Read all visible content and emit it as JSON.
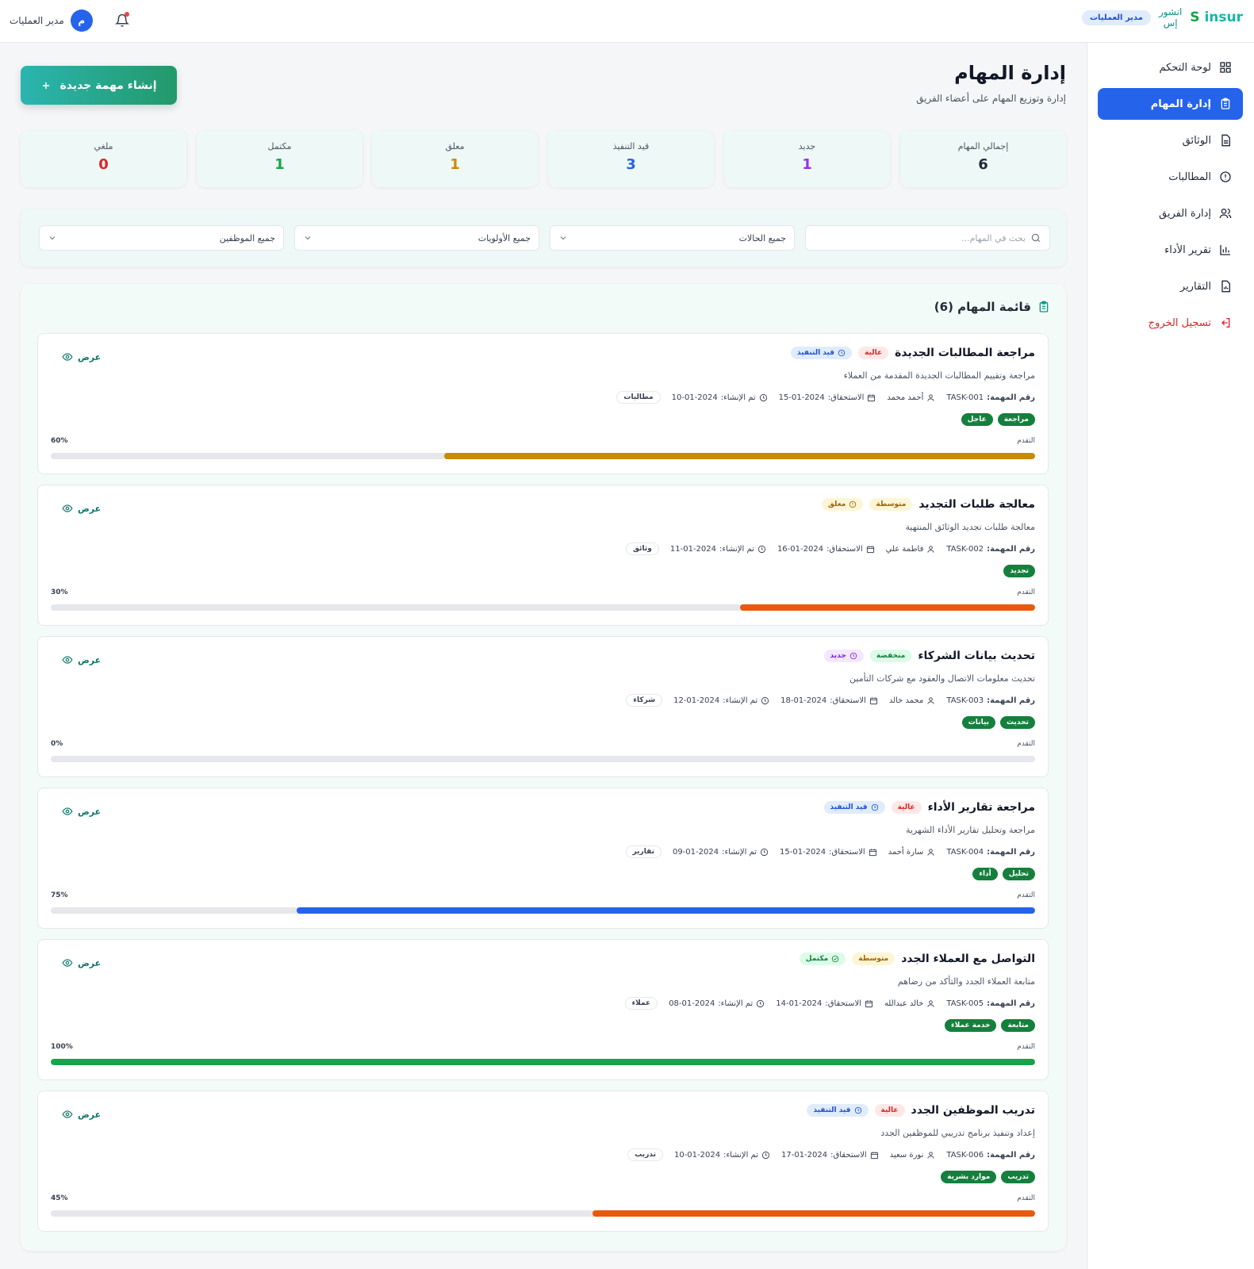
{
  "brand": {
    "logo_main": "insur",
    "logo_s": "S",
    "arabic_line1": "انشور",
    "arabic_line2": "إس",
    "role_pill": "مدير العمليات"
  },
  "user": {
    "name": "مدير العمليات",
    "avatar_letter": "م"
  },
  "sidebar": {
    "items": [
      {
        "label": "لوحة التحكم",
        "icon": "dashboard-icon"
      },
      {
        "label": "إدارة المهام",
        "icon": "clipboard-icon",
        "active": true
      },
      {
        "label": "الوثائق",
        "icon": "document-icon"
      },
      {
        "label": "المطالبات",
        "icon": "alert-circle-icon"
      },
      {
        "label": "إدارة الفريق",
        "icon": "users-icon"
      },
      {
        "label": "تقرير الأداء",
        "icon": "bar-chart-icon"
      },
      {
        "label": "التقارير",
        "icon": "report-icon"
      },
      {
        "label": "تسجيل الخروج",
        "icon": "logout-icon"
      }
    ]
  },
  "page": {
    "title": "إدارة المهام",
    "subtitle": "إدارة وتوزيع المهام على أعضاء الفريق",
    "create_button": "إنشاء مهمة جديدة"
  },
  "stats": [
    {
      "label": "إجمالي المهام",
      "value": "6",
      "color": "#1f2937"
    },
    {
      "label": "جديد",
      "value": "1",
      "color": "#9333ea"
    },
    {
      "label": "قيد التنفيذ",
      "value": "3",
      "color": "#2563eb"
    },
    {
      "label": "معلق",
      "value": "1",
      "color": "#ca8a04"
    },
    {
      "label": "مكتمل",
      "value": "1",
      "color": "#16a34a"
    },
    {
      "label": "ملغي",
      "value": "0",
      "color": "#dc2626"
    }
  ],
  "filters": {
    "search_placeholder": "بحث في المهام...",
    "status": "جميع الحالات",
    "priority": "جميع الأولويات",
    "employee": "جميع الموظفين"
  },
  "list": {
    "title": "قائمة المهام (6)"
  },
  "labels": {
    "task_no": "رقم المهمة:",
    "due": "الاستحقاق:",
    "created": "تم الإنشاء:",
    "progress": "التقدم",
    "view": "عرض"
  },
  "tasks": [
    {
      "title": "مراجعة المطالبات الجديدة",
      "priority": "عالية",
      "priority_class": "pr-high",
      "status": "قيد التنفيذ",
      "status_class": "st-progress",
      "description": "مراجعة وتقييم المطالبات الجديدة المقدمة من العملاء",
      "id": "TASK-001",
      "assignee": "أحمد محمد",
      "due": "15-01-2024",
      "created": "10-01-2024",
      "category": "مطالبات",
      "tags": [
        "مراجعة",
        "عاجل"
      ],
      "progress": 60,
      "progress_text": "60%",
      "bar_color": "#ca8a04"
    },
    {
      "title": "معالجة طلبات التجديد",
      "priority": "متوسطة",
      "priority_class": "pr-med",
      "status": "معلق",
      "status_class": "st-pending",
      "description": "معالجة طلبات تجديد الوثائق المنتهية",
      "id": "TASK-002",
      "assignee": "فاطمة علي",
      "due": "16-01-2024",
      "created": "11-01-2024",
      "category": "وثائق",
      "tags": [
        "تجديد"
      ],
      "progress": 30,
      "progress_text": "30%",
      "bar_color": "#ea580c"
    },
    {
      "title": "تحديث بيانات الشركاء",
      "priority": "منخفضة",
      "priority_class": "pr-low",
      "status": "جديد",
      "status_class": "st-new",
      "description": "تحديث معلومات الاتصال والعقود مع شركات التأمين",
      "id": "TASK-003",
      "assignee": "محمد خالد",
      "due": "18-01-2024",
      "created": "12-01-2024",
      "category": "شركاء",
      "tags": [
        "تحديث",
        "بيانات"
      ],
      "progress": 0,
      "progress_text": "0%",
      "bar_color": "#9ca3af"
    },
    {
      "title": "مراجعة تقارير الأداء",
      "priority": "عالية",
      "priority_class": "pr-high",
      "status": "قيد التنفيذ",
      "status_class": "st-progress",
      "description": "مراجعة وتحليل تقارير الأداء الشهرية",
      "id": "TASK-004",
      "assignee": "سارة أحمد",
      "due": "15-01-2024",
      "created": "09-01-2024",
      "category": "تقارير",
      "tags": [
        "تحليل",
        "أداء"
      ],
      "progress": 75,
      "progress_text": "75%",
      "bar_color": "#2563eb"
    },
    {
      "title": "التواصل مع العملاء الجدد",
      "priority": "متوسطة",
      "priority_class": "pr-med",
      "status": "مكتمل",
      "status_class": "st-done",
      "description": "متابعة العملاء الجدد والتأكد من رضاهم",
      "id": "TASK-005",
      "assignee": "خالد عبدالله",
      "due": "14-01-2024",
      "created": "08-01-2024",
      "category": "عملاء",
      "tags": [
        "متابعة",
        "خدمة عملاء"
      ],
      "progress": 100,
      "progress_text": "100%",
      "bar_color": "#16a34a"
    },
    {
      "title": "تدريب الموظفين الجدد",
      "priority": "عالية",
      "priority_class": "pr-high",
      "status": "قيد التنفيذ",
      "status_class": "st-progress",
      "description": "إعداد وتنفيذ برنامج تدريبي للموظفين الجدد",
      "id": "TASK-006",
      "assignee": "نورة سعيد",
      "due": "17-01-2024",
      "created": "10-01-2024",
      "category": "تدريب",
      "tags": [
        "تدريب",
        "موارد بشرية"
      ],
      "progress": 45,
      "progress_text": "45%",
      "bar_color": "#ea580c"
    }
  ]
}
